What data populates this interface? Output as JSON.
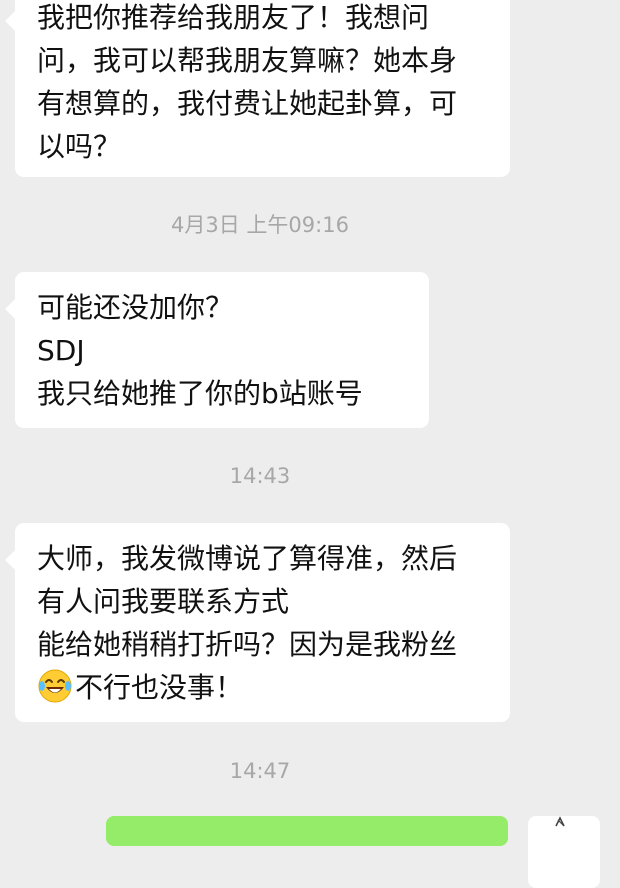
{
  "messages": [
    {
      "lines": [
        "我把你推荐给我朋友了！我想问",
        "问，我可以帮我朋友算嘛？她本身",
        "有想算的，我付费让她起卦算，可",
        "以吗？"
      ]
    },
    {
      "lines": [
        "可能还没加你？",
        "SDJ",
        "我只给她推了你的b站账号"
      ]
    },
    {
      "lines": [
        "大师，我发微博说了算得准，然后",
        "有人问我要联系方式",
        "能给她稍稍打折吗？因为是我粉丝"
      ],
      "last_line": "不行也没事！",
      "emoji": "laughing-tears-emoji"
    }
  ],
  "timestamps": [
    "4月3日 上午09:16",
    "14:43",
    "14:47"
  ],
  "colors": {
    "background": "#ededed",
    "incoming_bubble": "#ffffff",
    "outgoing_bubble": "#95ec69",
    "timestamp_text": "#a7a7a7"
  }
}
